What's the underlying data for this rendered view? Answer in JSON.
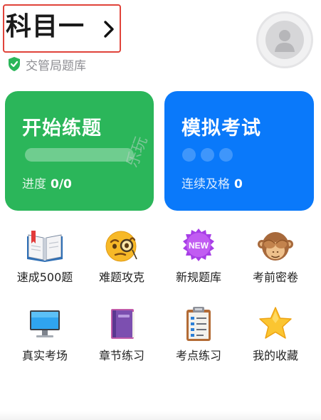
{
  "header": {
    "subject": "科目一",
    "source": "交管局题库"
  },
  "cards": {
    "practice": {
      "title": "开始练题",
      "stat_label": "进度",
      "stat_value": "0/0",
      "progress": 0
    },
    "mock": {
      "title": "模拟考试",
      "stat_label": "连续及格",
      "stat_value": "0"
    }
  },
  "watermark": "乐玩",
  "features": [
    {
      "label": "速成500题",
      "icon": "book-icon"
    },
    {
      "label": "难题攻克",
      "icon": "monocle-face-icon"
    },
    {
      "label": "新规题库",
      "icon": "new-badge-icon"
    },
    {
      "label": "考前密卷",
      "icon": "see-no-evil-monkey-icon"
    },
    {
      "label": "真实考场",
      "icon": "monitor-icon"
    },
    {
      "label": "章节练习",
      "icon": "notebook-icon"
    },
    {
      "label": "考点练习",
      "icon": "clipboard-icon"
    },
    {
      "label": "我的收藏",
      "icon": "star-icon"
    }
  ],
  "colors": {
    "green_card": "#2bb65a",
    "blue_card": "#0a79fa",
    "highlight_border": "#e0433a"
  }
}
